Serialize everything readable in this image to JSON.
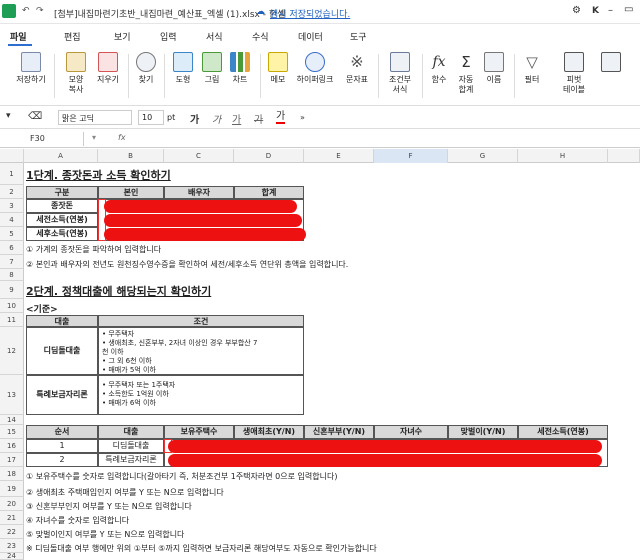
{
  "titlebar": {
    "doc_title": "[첨부]내집마련기초반_내집마련_예산표_엑셀 (1).xlsx - 한셀",
    "save_note": "임시 저장되었습니다.",
    "user_initial": "K"
  },
  "menu": [
    "파일",
    "편집",
    "보기",
    "입력",
    "서식",
    "수식",
    "데이터",
    "도구"
  ],
  "ribbon": {
    "save": "저장하기",
    "format_copy": "모양\n복사",
    "clear": "지우기",
    "find": "찾기",
    "shapes": "도형",
    "picture": "그림",
    "chart": "차트",
    "memo": "메모",
    "hyperlink": "하이퍼링크",
    "symbol": "문자표",
    "cond_format": "조건부\n서식",
    "function": "함수",
    "autosum": "자동\n합계",
    "name": "이름",
    "filter": "필터",
    "pivot": "피벗\n테이블"
  },
  "format": {
    "font": "맑은 고딕",
    "size": "10",
    "unit": "pt",
    "bold": "가",
    "italic": "가",
    "underline": "가",
    "strike": "가",
    "color": "가"
  },
  "formula": {
    "cell": "F30",
    "fx": "fx"
  },
  "columns": [
    "A",
    "B",
    "C",
    "D",
    "E",
    "F",
    "G",
    "H"
  ],
  "rows": [
    "1",
    "2",
    "3",
    "4",
    "5",
    "6",
    "7",
    "8",
    "9",
    "10",
    "11",
    "12",
    "13",
    "14",
    "15",
    "16",
    "17",
    "18",
    "19",
    "20",
    "21",
    "22",
    "23",
    "24"
  ],
  "sheet": {
    "step1_title": "1단계. 종잣돈과 소득 확인하기",
    "step1_headers": [
      "구분",
      "본인",
      "배우자",
      "합계"
    ],
    "step1_rows": [
      "종잣돈",
      "세전소득(연봉)",
      "세후소득(연봉)"
    ],
    "note6": "① 가계의 종잣돈을 파악하여 입력합니다",
    "note7": "② 본인과 배우자의 전년도 원천징수영수증을 확인하여 세전/세후소득 연단위 총액을 입력합니다.",
    "step2_title": "2단계. 정책대출에 해당되는지 확인하기",
    "criteria_label": "<기준>",
    "crit_headers": [
      "대출",
      "조건"
    ],
    "loan1": "디딤돌대출",
    "loan1_cond": [
      "• 무주택자",
      "• 생애최초, 신혼부부, 2자녀 이상인 경우 부부합산 7",
      "천 이하",
      "• 그 외 6천 이하",
      "• 매매가 5억 이하"
    ],
    "loan2": "특례보금자리론",
    "loan2_cond": [
      "• 무주택자 또는 1주택자",
      "• 소득한도 1억원 이하",
      "• 매매가 6억 이하"
    ],
    "check_headers": [
      "순서",
      "대출",
      "보유주택수",
      "생애최초(Y/N)",
      "신혼부부(Y/N)",
      "자녀수",
      "맞벌이(Y/N)",
      "세전소득(연봉)"
    ],
    "check_rows": [
      {
        "no": "1",
        "loan": "디딤돌대출"
      },
      {
        "no": "2",
        "loan": "특례보금자리론"
      }
    ],
    "notes": [
      "① 보유주택수를 숫자로 입력합니다(갈아타기 즉, 처분조건부 1주택자라면 0으로 입력합니다)",
      "② 생애최초 주택매입인지 여부를 Y 또는 N으로 입력합니다",
      "③ 신혼부부인지 여부를 Y 또는 N으로 입력합니다",
      "④ 자녀수를 숫자로 입력합니다",
      "⑤ 맞벌이인지 여부를 Y 또는 N으로 입력합니다",
      "※ 디딤돌대출 여부 행에만 위의 ①부터 ⑤까지 입력하면 보금자리론 해당여부도 자동으로 확인가능합니다"
    ]
  }
}
